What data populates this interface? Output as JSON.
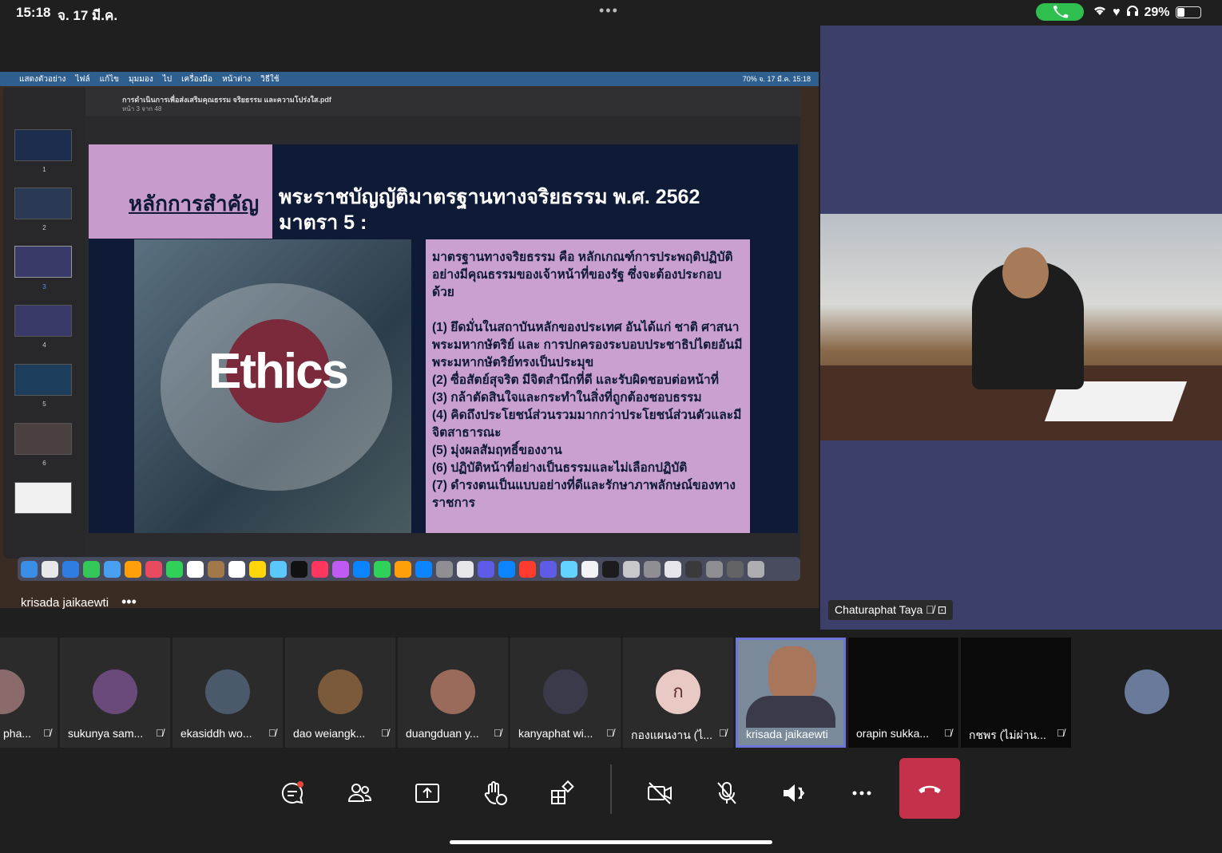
{
  "status": {
    "time": "15:18",
    "date": "จ. 17 มี.ค.",
    "battery": "29%",
    "battery_level": 0.29
  },
  "shared_screen": {
    "mac_menu": [
      "แสดงตัวอย่าง",
      "ไฟล์",
      "แก้ไข",
      "มุมมอง",
      "ไป",
      "เครื่องมือ",
      "หน้าต่าง",
      "วิธีใช้"
    ],
    "mac_menu_right": "70%   จ. 17 มี.ค. 15:18",
    "pdf_filename": "การดำเนินการเพื่อส่งเสริมคุณธรรม จริยธรรม และความโปร่งใส.pdf",
    "pdf_page_info": "หน้า 3 จาก 48",
    "thumb_numbers": [
      "1",
      "2",
      "3",
      "4",
      "5",
      "6"
    ],
    "slide": {
      "heading": "หลักการสำคัญ",
      "title_line1": "พระราชบัญญัติมาตรฐานทางจริยธรรม พ.ศ. 2562",
      "title_line2": "มาตรา 5 :",
      "image_word": "Ethics",
      "intro": "มาตรฐานทางจริยธรรม คือ หลักเกณฑ์การประพฤติปฏิบัติอย่างมีคุณธรรมของเจ้าหน้าที่ของรัฐ ซึ่งจะต้องประกอบด้วย",
      "items": [
        "(1) ยึดมั่นในสถาบันหลักของประเทศ อันได้แก่ ชาติ ศาสนา พระมหากษัตริย์ และ การปกครองระบอบประชาธิปไตยอันมีพระมหากษัตริย์ทรงเป็นประมุข",
        "(2) ซื่อสัตย์สุจริต มีจิตสำนึกที่ดี และรับผิดชอบต่อหน้าที่",
        "(3) กล้าตัดสินใจและกระทำในสิ่งที่ถูกต้องชอบธรรม",
        "(4) คิดถึงประโยชน์ส่วนรวมมากกว่าประโยชน์ส่วนตัวและมีจิตสาธารณะ",
        "(5) มุ่งผลสัมฤทธิ์ของงาน",
        "(6) ปฏิบัติหน้าที่อย่างเป็นธรรมและไม่เลือกปฏิบัติ",
        "(7) ดำรงตนเป็นแบบอย่างที่ดีและรักษาภาพลักษณ์ของทางราชการ"
      ]
    },
    "presenter_name": "krisada jaikaewti",
    "more_glyph": "•••"
  },
  "right_video": {
    "name": "Chaturaphat Taya"
  },
  "participants": [
    {
      "name": "pha...",
      "initial": ""
    },
    {
      "name": "sukunya sam...",
      "initial": ""
    },
    {
      "name": "ekasiddh wo...",
      "initial": ""
    },
    {
      "name": "dao weiangk...",
      "initial": ""
    },
    {
      "name": "duangduan y...",
      "initial": ""
    },
    {
      "name": "kanyaphat wi...",
      "initial": ""
    },
    {
      "name": "กองแผนงาน (ไ...",
      "initial": "ก"
    },
    {
      "name": "krisada jaikaewti",
      "initial": ""
    },
    {
      "name": "orapin sukka...",
      "initial": ""
    },
    {
      "name": "กชพร (ไม่ผ่าน...",
      "initial": ""
    }
  ],
  "controls": {
    "items": [
      "chat-icon",
      "people-icon",
      "share-icon",
      "raise-hand-icon",
      "apps-icon",
      "camera-off-icon",
      "mic-off-icon",
      "speaker-icon",
      "more-icon",
      "hang-up-icon"
    ],
    "hangup_color": "#c4314b"
  },
  "colors": {
    "slide_bg": "#0e1a36",
    "slide_pink": "#c9a0cf",
    "right_pane": "#3b3f6a",
    "active_tile": "#6f74d8",
    "call_pill": "#2fbf4f"
  }
}
